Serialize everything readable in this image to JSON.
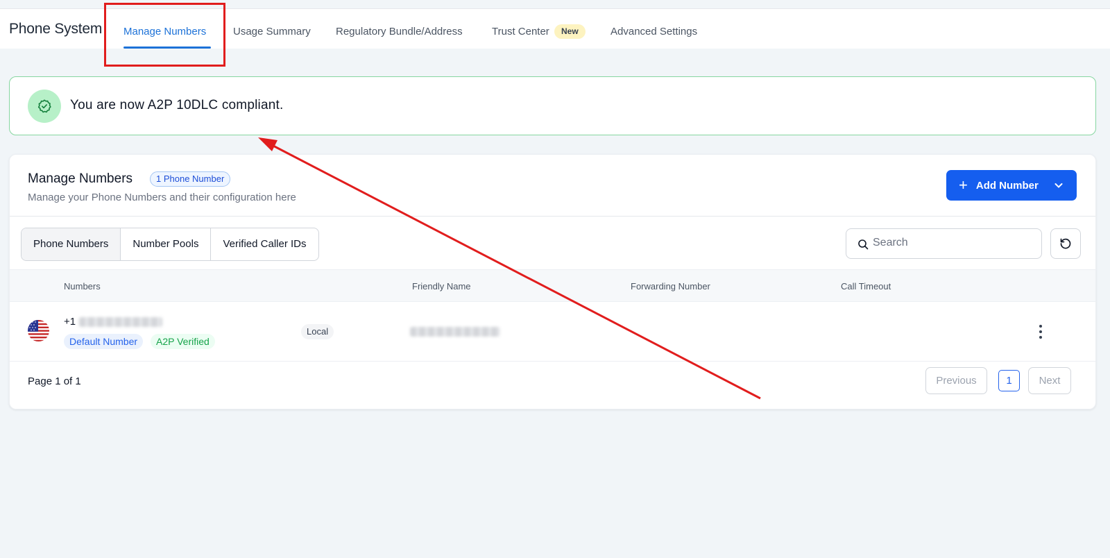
{
  "app": {
    "title": "Phone System"
  },
  "tabs": [
    {
      "label": "Manage Numbers",
      "active": true
    },
    {
      "label": "Usage Summary"
    },
    {
      "label": "Regulatory Bundle/Address"
    },
    {
      "label": "Trust Center",
      "badge": "New"
    },
    {
      "label": "Advanced Settings"
    }
  ],
  "alert": {
    "text": "You are now A2P 10DLC compliant.",
    "icon": "shield-check-icon"
  },
  "card": {
    "title": "Manage Numbers",
    "count_badge": "1 Phone Number",
    "subtitle": "Manage your Phone Numbers and their configuration here",
    "add_button": "Add Number"
  },
  "segments": [
    {
      "label": "Phone Numbers",
      "active": true
    },
    {
      "label": "Number Pools"
    },
    {
      "label": "Verified Caller IDs"
    }
  ],
  "search": {
    "placeholder": "Search"
  },
  "table": {
    "columns": [
      "Numbers",
      "Friendly Name",
      "Forwarding Number",
      "Call Timeout"
    ],
    "rows": [
      {
        "country_flag": "us-flag-icon",
        "number_prefix": "+1",
        "tags": [
          "Default Number",
          "A2P Verified"
        ],
        "type": "Local",
        "forwarding_number": "",
        "call_timeout": ""
      }
    ]
  },
  "pagination": {
    "label": "Page 1 of 1",
    "previous": "Previous",
    "current": "1",
    "next": "Next"
  },
  "colors": {
    "accent": "#155eef",
    "tab_active": "#1d72d8",
    "success": "#16a34a",
    "annotation": "#e11d1d"
  }
}
